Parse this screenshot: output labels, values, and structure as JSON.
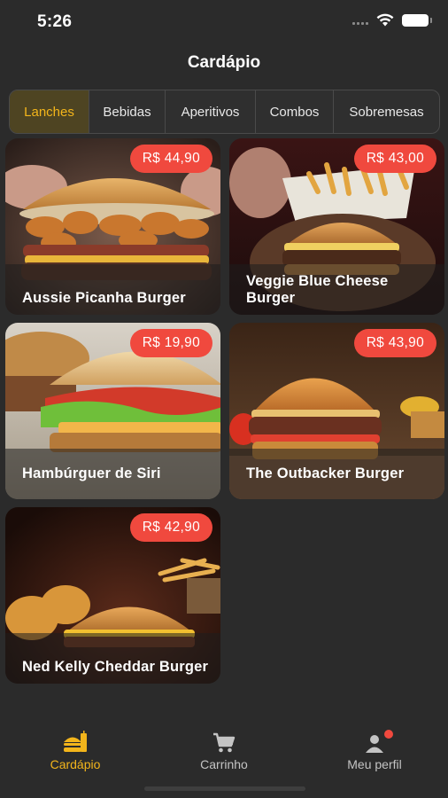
{
  "status_bar": {
    "time": "5:26"
  },
  "header": {
    "title": "Cardápio"
  },
  "tabs": [
    {
      "label": "Lanches",
      "active": true
    },
    {
      "label": "Bebidas",
      "active": false
    },
    {
      "label": "Aperitivos",
      "active": false
    },
    {
      "label": "Combos",
      "active": false
    },
    {
      "label": "Sobremesas",
      "active": false
    }
  ],
  "products": [
    {
      "name": "Aussie Picanha Burger",
      "price": "R$ 44,90"
    },
    {
      "name": "Veggie Blue Cheese Burger",
      "price": "R$ 43,00"
    },
    {
      "name": "Hambúrguer de Siri",
      "price": "R$ 19,90"
    },
    {
      "name": "The Outbacker Burger",
      "price": "R$ 43,90"
    },
    {
      "name": "Ned Kelly Cheddar Burger",
      "price": "R$ 42,90"
    }
  ],
  "bottom_nav": [
    {
      "label": "Cardápio",
      "icon": "burger-menu-icon",
      "active": true
    },
    {
      "label": "Carrinho",
      "icon": "cart-icon",
      "active": false
    },
    {
      "label": "Meu perfil",
      "icon": "profile-icon",
      "active": false
    }
  ],
  "colors": {
    "background": "#2b2b2b",
    "accent": "#f3b51b",
    "price_badge": "#f0493e",
    "active_tab_bg": "#4e4422"
  }
}
